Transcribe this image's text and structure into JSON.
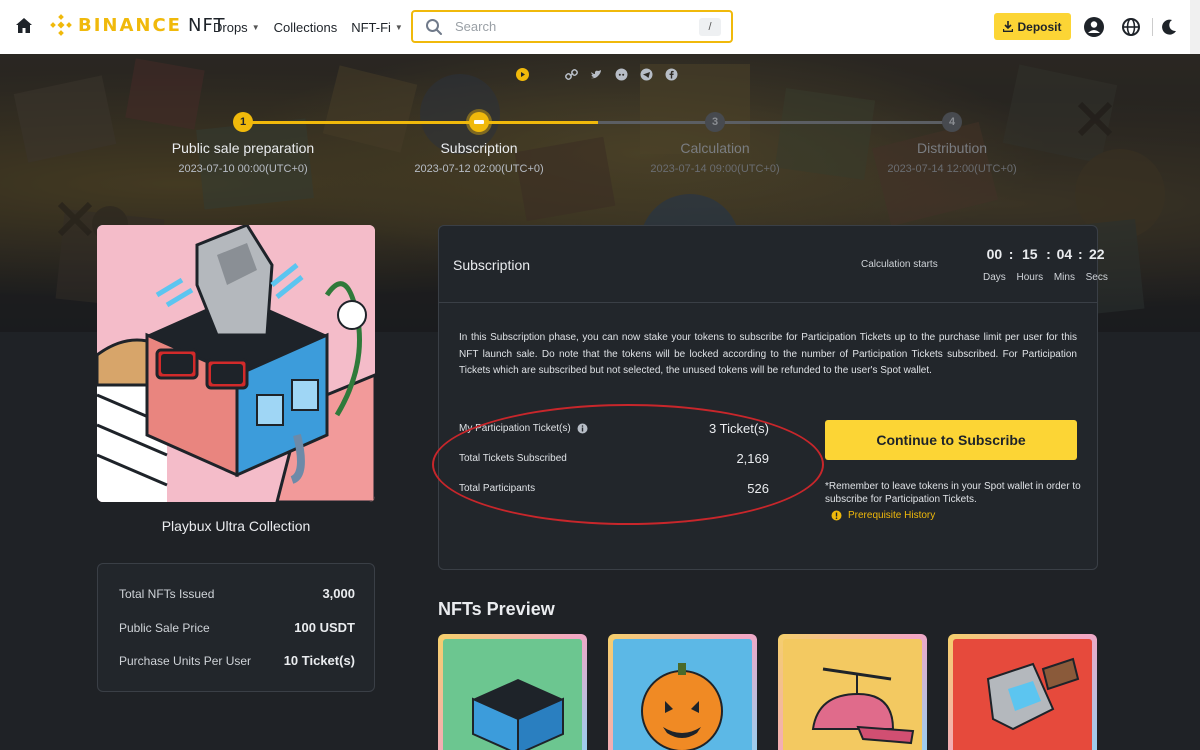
{
  "header": {
    "logo_text": "BINANCE",
    "logo_suffix": "NFT",
    "nav": [
      {
        "label": "Drops",
        "has_caret": true
      },
      {
        "label": "Collections",
        "has_caret": false
      },
      {
        "label": "NFT-Fi",
        "has_caret": true
      }
    ],
    "search_placeholder": "Search",
    "search_shortcut": "/",
    "deposit_label": "Deposit",
    "icons": [
      "home-icon",
      "search-icon",
      "download-icon",
      "user-icon",
      "globe-icon",
      "moon-icon"
    ]
  },
  "colors": {
    "brand": "#f0b90b",
    "cta": "#fcd535",
    "annotation": "#c8262b"
  },
  "steps": [
    {
      "num": "1",
      "title": "Public sale preparation",
      "date": "2023-07-10 00:00(UTC+0)",
      "state": "done"
    },
    {
      "num": "",
      "title": "Subscription",
      "date": "2023-07-12 02:00(UTC+0)",
      "state": "active"
    },
    {
      "num": "3",
      "title": "Calculation",
      "date": "2023-07-14 09:00(UTC+0)",
      "state": "pending"
    },
    {
      "num": "4",
      "title": "Distribution",
      "date": "2023-07-14 12:00(UTC+0)",
      "state": "pending"
    }
  ],
  "collection": {
    "name": "Playbux Ultra Collection",
    "stats": [
      {
        "label": "Total NFTs Issued",
        "value": "3,000"
      },
      {
        "label": "Public Sale Price",
        "value": "100 USDT"
      },
      {
        "label": "Purchase Units Per User",
        "value": "10 Ticket(s)"
      }
    ]
  },
  "subscription": {
    "title": "Subscription",
    "calc_label": "Calculation starts",
    "countdown": {
      "days": "00",
      "hours": "15",
      "mins": "04",
      "secs": "22",
      "units": [
        "Days",
        "Hours",
        "Mins",
        "Secs"
      ]
    },
    "description": "In this Subscription phase, you can now stake your tokens to subscribe for Participation Tickets up to the purchase limit per user for this NFT launch sale. Do note that the tokens will be locked according to the number of Participation Tickets subscribed. For Participation Tickets which are subscribed but not selected, the unused tokens will be refunded to the user's Spot wallet.",
    "info": [
      {
        "label": "My Participation Ticket(s)",
        "value": "3 Ticket(s)",
        "has_info": true
      },
      {
        "label": "Total Tickets Subscribed",
        "value": "2,169",
        "has_info": false
      },
      {
        "label": "Total Participants",
        "value": "526",
        "has_info": false
      }
    ],
    "cta_label": "Continue to Subscribe",
    "reminder": "*Remember to leave tokens in your Spot wallet in order to subscribe for Participation Tickets.",
    "prereq_label": "Prerequisite History"
  },
  "preview": {
    "title": "NFTs Preview"
  }
}
